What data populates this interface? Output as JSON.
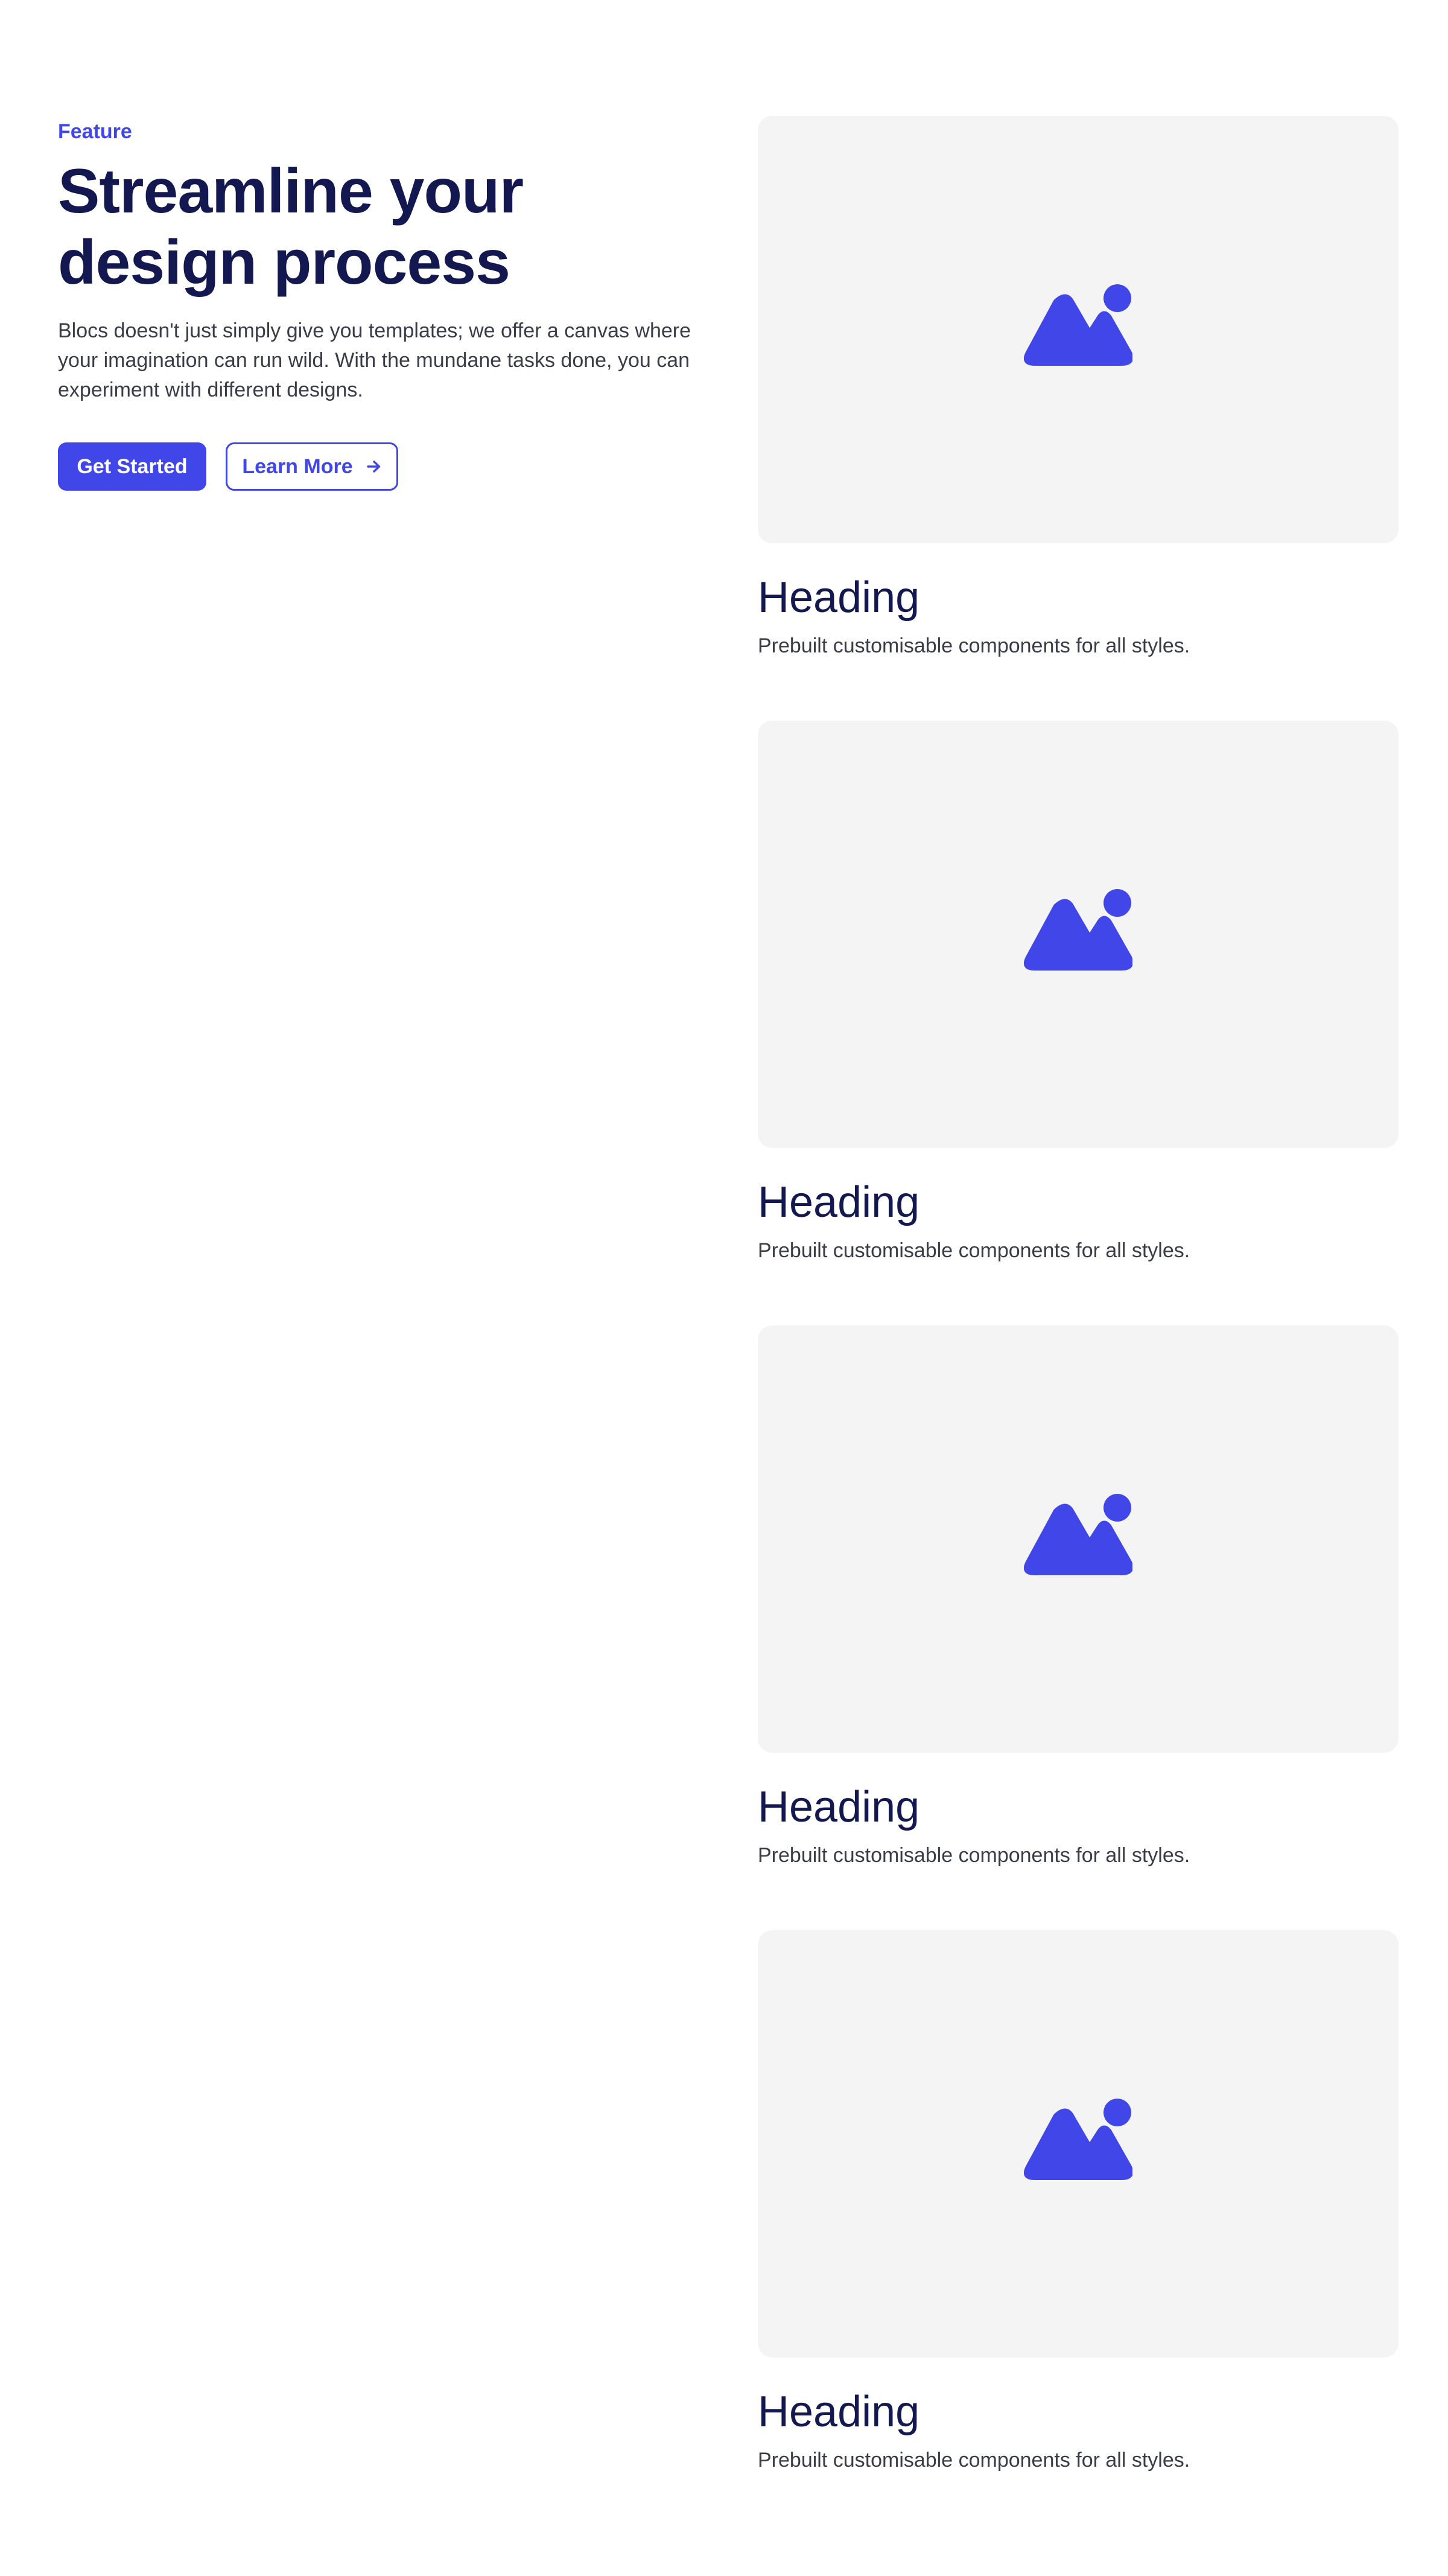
{
  "hero": {
    "eyebrow": "Feature",
    "title_line1": "Streamline your",
    "title_line2": "design process",
    "description": "Blocs doesn't just simply give you templates; we offer a canvas where your imagination can run wild. With the mundane tasks done, you can experiment with different designs.",
    "primary_button": "Get Started",
    "secondary_button": "Learn More",
    "secondary_button_icon": "arrow-right-icon"
  },
  "cards": [
    {
      "heading": "Heading",
      "text": "Prebuilt customisable components for all styles.",
      "icon": "image-placeholder-icon"
    },
    {
      "heading": "Heading",
      "text": "Prebuilt customisable components for all styles.",
      "icon": "image-placeholder-icon"
    },
    {
      "heading": "Heading",
      "text": "Prebuilt customisable components for all styles.",
      "icon": "image-placeholder-icon"
    },
    {
      "heading": "Heading",
      "text": "Prebuilt customisable components for all styles.",
      "icon": "image-placeholder-icon"
    }
  ],
  "colors": {
    "accent": "#4046e8",
    "heading": "#141850",
    "body": "#3a3d48",
    "placeholder_bg": "#f4f4f4"
  }
}
